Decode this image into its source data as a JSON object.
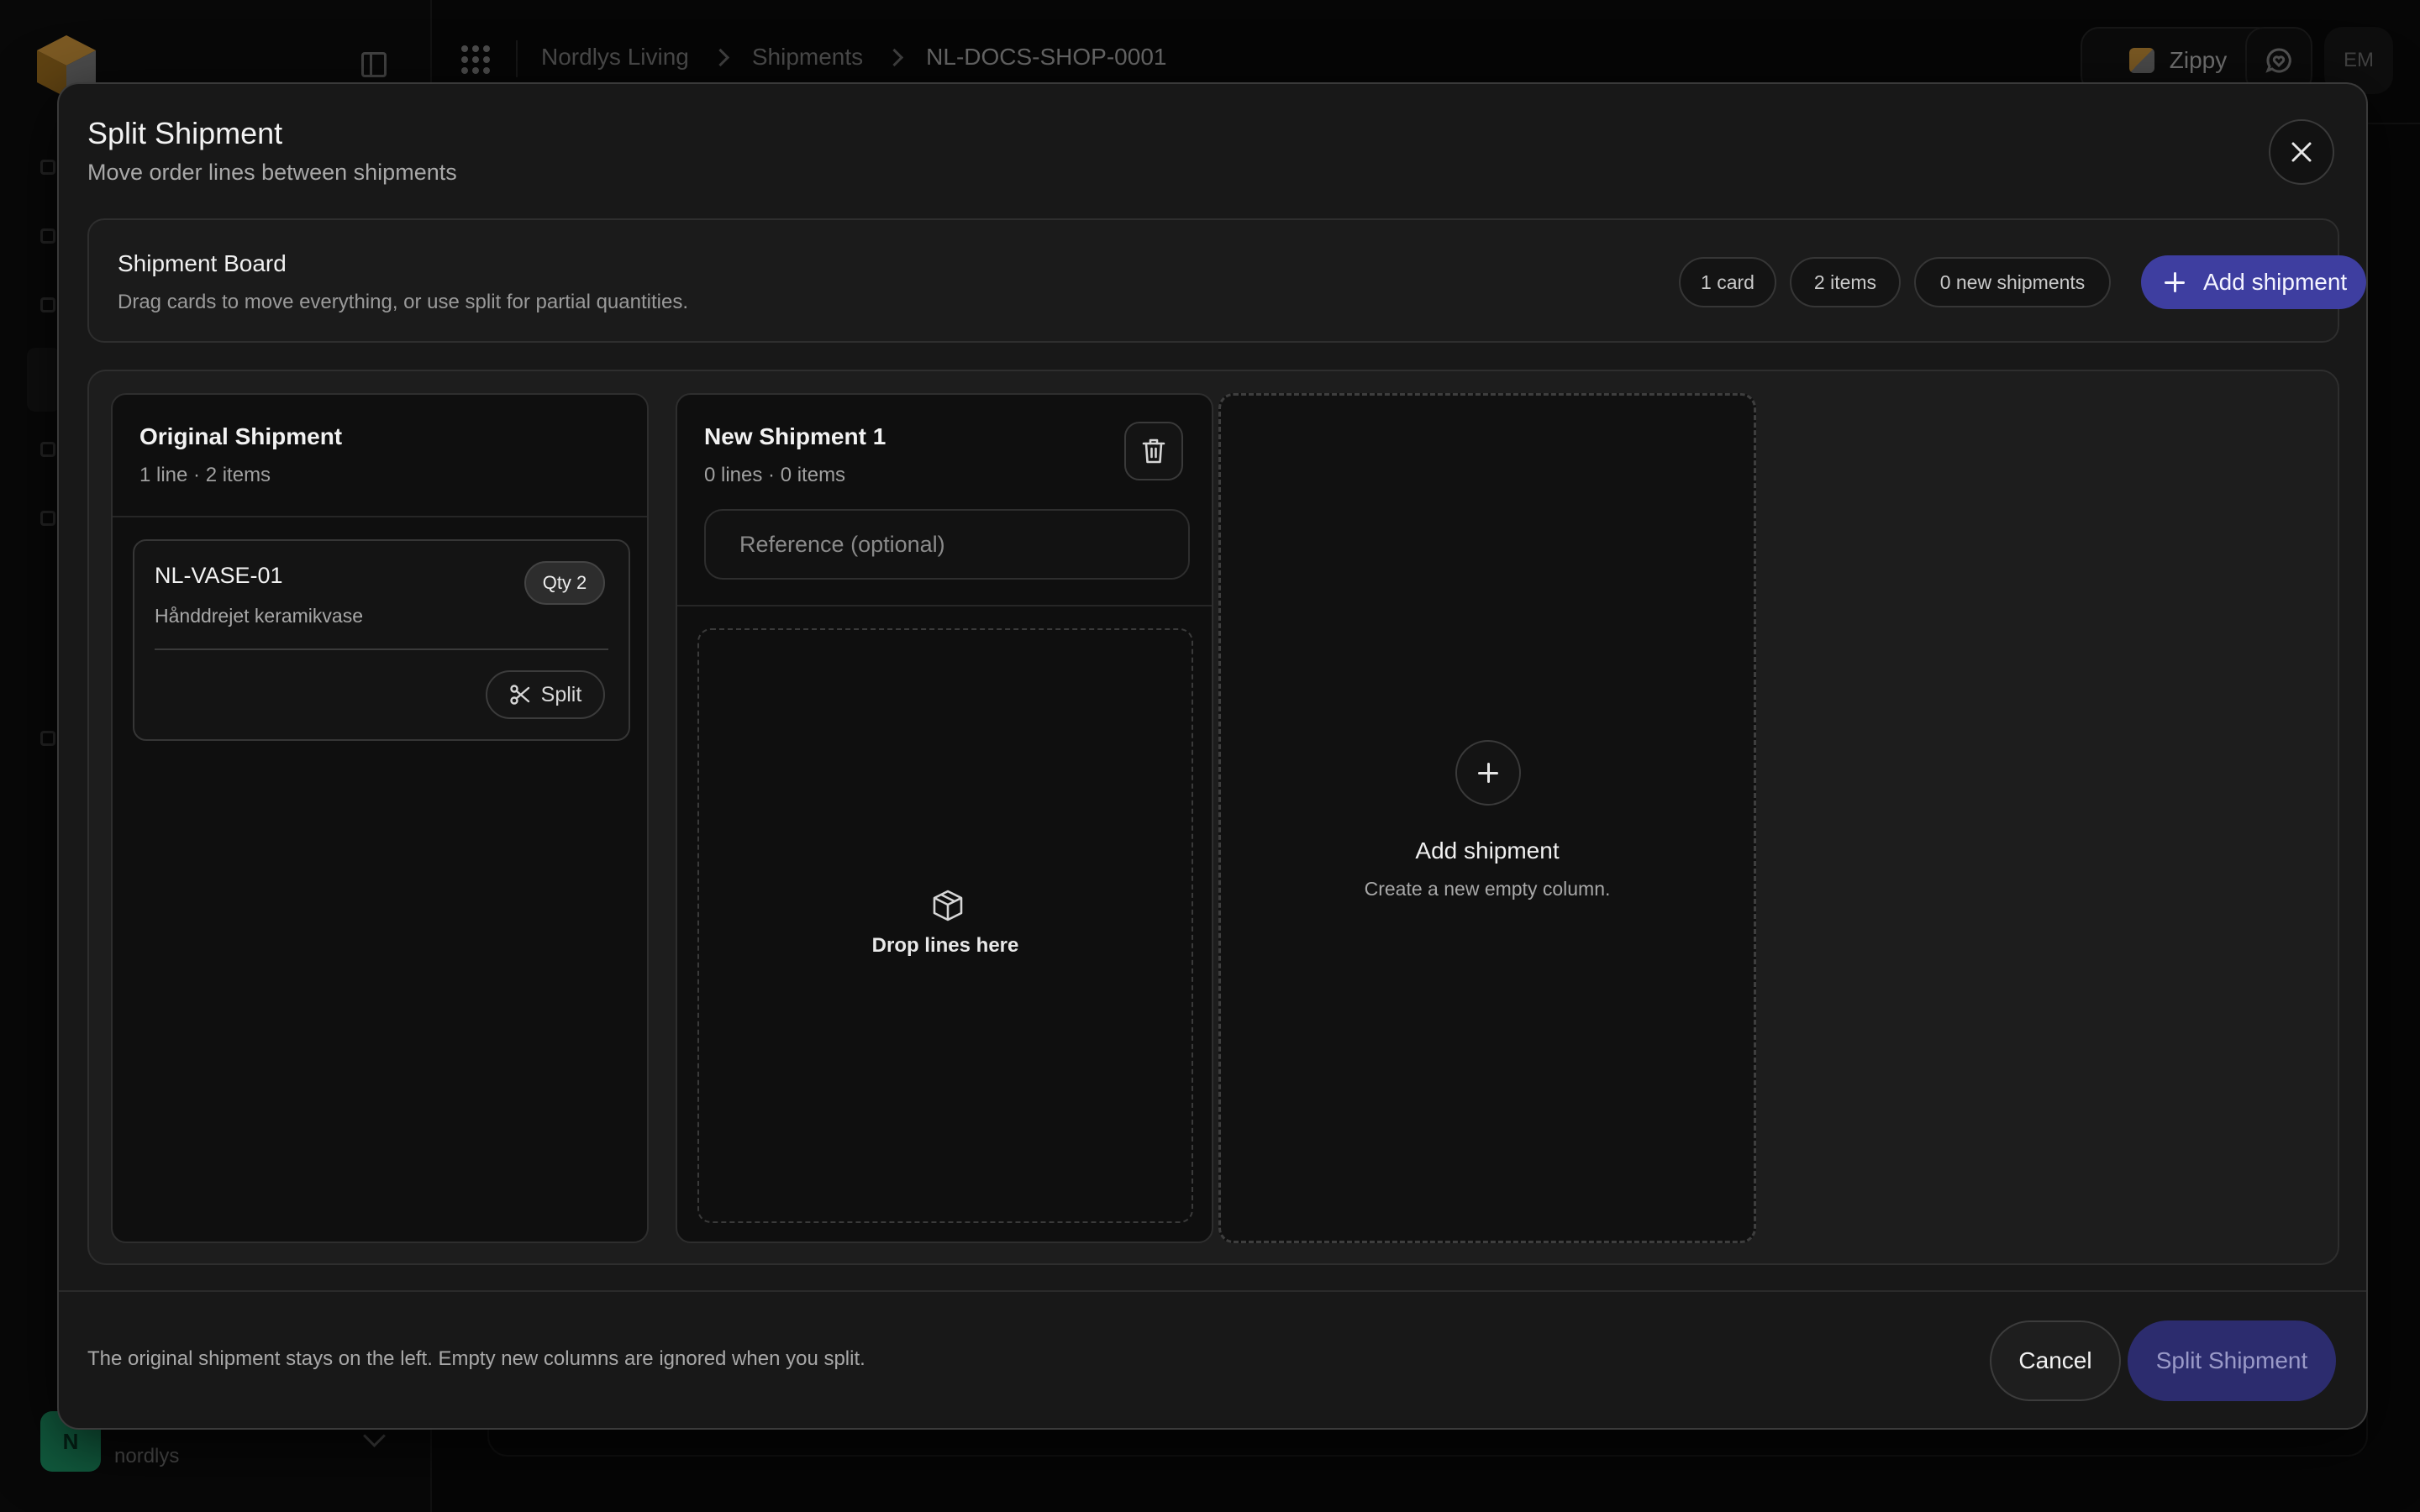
{
  "app": {
    "breadcrumb": [
      "Nordlys Living",
      "Shipments",
      "NL-DOCS-SHOP-0001"
    ],
    "carrier": "Zippy",
    "user_initials": "EM",
    "org_avatar": "N",
    "org_slug": "nordlys"
  },
  "modal": {
    "title": "Split Shipment",
    "subtitle": "Move order lines between shipments",
    "board": {
      "title": "Shipment Board",
      "description": "Drag cards to move everything, or use split for partial quantities.",
      "stats": [
        "1 card",
        "2 items",
        "0 new shipments"
      ],
      "add_button": "Add shipment"
    },
    "original": {
      "title": "Original Shipment",
      "meta": "1 line · 2 items",
      "line": {
        "sku": "NL-VASE-01",
        "name": "Hånddrejet keramikvase",
        "qty": "Qty 2",
        "split_label": "Split"
      }
    },
    "new_shipment": {
      "title": "New Shipment 1",
      "meta": "0 lines · 0 items",
      "reference_placeholder": "Reference (optional)",
      "drop_text": "Drop lines here"
    },
    "add_column": {
      "title": "Add shipment",
      "description": "Create a new empty column."
    },
    "footer": {
      "note": "The original shipment stays on the left. Empty new columns are ignored when you split.",
      "cancel": "Cancel",
      "submit": "Split Shipment"
    }
  },
  "colors": {
    "accent": "#3e3ea0",
    "accent_disabled": "#2c2c6e",
    "org_green": "#1fa672"
  }
}
